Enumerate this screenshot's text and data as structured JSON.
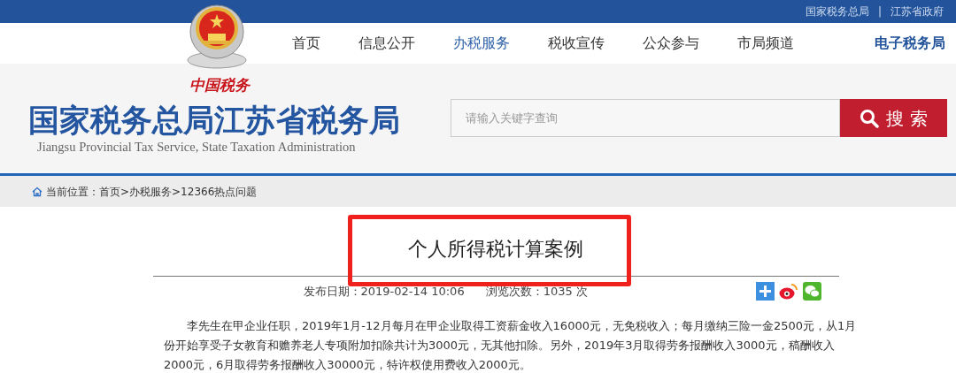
{
  "top_links": [
    "国家税务总局",
    "江苏省政府"
  ],
  "top_separator": "|",
  "nav": [
    {
      "label": "首页",
      "selected": false
    },
    {
      "label": "信息公开",
      "selected": false
    },
    {
      "label": "办税服务",
      "selected": true
    },
    {
      "label": "税收宣传",
      "selected": false
    },
    {
      "label": "公众参与",
      "selected": false
    },
    {
      "label": "市局频道",
      "selected": false
    }
  ],
  "nav_right": "电子税务局",
  "logo": {
    "slogan": "中国税务",
    "title": "国家税务总局江苏省税务局",
    "subtitle": "Jiangsu Provincial Tax Service, State Taxation Administration"
  },
  "search": {
    "placeholder": "请输入关键字查询",
    "button": "搜 索"
  },
  "breadcrumb": {
    "label": "当前位置：",
    "path": "首页>办税服务>12366热点问题"
  },
  "article": {
    "title": "个人所得税计算案例",
    "date_label": "发布日期：",
    "date": "2019-02-14 10:06",
    "views_label": "浏览次数：",
    "views": "1035 次",
    "body": "李先生在甲企业任职，2019年1月-12月每月在甲企业取得工资薪金收入16000元，无免税收入；每月缴纳三险一金2500元，从1月份开始享受子女教育和赡养老人专项附加扣除共计为3000元，无其他扣除。另外，2019年3月取得劳务报酬收入3000元，稿酬收入2000元，6月取得劳务报酬收入30000元，特许权使用费收入2000元。"
  }
}
